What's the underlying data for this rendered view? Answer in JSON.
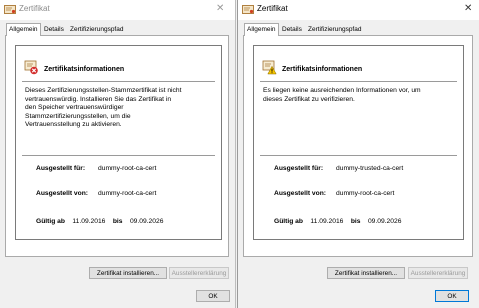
{
  "windows": [
    {
      "title": "Zertifikat",
      "tabs": [
        "Allgemein",
        "Details",
        "Zertifizierungspfad"
      ],
      "active_tab": "Allgemein",
      "heading": "Zertifikatsinformationen",
      "status_icon": "certificate-error-icon",
      "message": "Dieses Zertifizierungsstellen-Stammzertifikat ist nicht\nvertrauenswürdig. Installieren Sie das Zertifikat in\nden Speicher vertrauenswürdiger\nStammzertifizierungsstellen, um die\nVertrauensstellung zu aktivieren.",
      "issued_to_label": "Ausgestellt für:",
      "issued_to": "dummy-root-ca-cert",
      "issued_by_label": "Ausgestellt von:",
      "issued_by": "dummy-root-ca-cert",
      "valid_from_label": "Gültig ab",
      "valid_from": "11.09.2016",
      "valid_to_label": "bis",
      "valid_to": "09.09.2026",
      "install_button": "Zertifikat installieren...",
      "statement_button": "Ausstellererklärung",
      "ok_button": "OK",
      "focused": false
    },
    {
      "title": "Zertifikat",
      "tabs": [
        "Allgemein",
        "Details",
        "Zertifizierungspfad"
      ],
      "active_tab": "Allgemein",
      "heading": "Zertifikatsinformationen",
      "status_icon": "certificate-warning-icon",
      "message": "Es liegen keine ausreichenden Informationen vor, um\ndieses Zertifikat zu verifizieren.",
      "issued_to_label": "Ausgestellt für:",
      "issued_to": "dummy-trusted-ca-cert",
      "issued_by_label": "Ausgestellt von:",
      "issued_by": "dummy-root-ca-cert",
      "valid_from_label": "Gültig ab",
      "valid_from": "11.09.2016",
      "valid_to_label": "bis",
      "valid_to": "09.09.2026",
      "install_button": "Zertifikat installieren...",
      "statement_button": "Ausstellererklärung",
      "ok_button": "OK",
      "focused": true
    }
  ]
}
